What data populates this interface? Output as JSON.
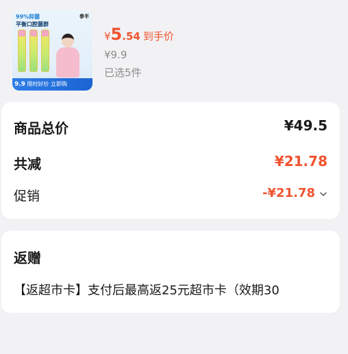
{
  "product": {
    "thumb": {
      "tagline_1": "99%抑菌",
      "tagline_2": "平衡口腔菌群",
      "brand": "参半",
      "promo_price": "9.9",
      "promo_text": "限时好价 立即购"
    },
    "price_currency": "¥",
    "price_integer": "5",
    "price_decimal": ".54",
    "price_label": "到手价",
    "original_price": "¥9.9",
    "selected_text": "已选5件"
  },
  "summary": {
    "total_label": "商品总价",
    "total_value": "¥49.5",
    "reduce_label": "共减",
    "reduce_value": "¥21.78",
    "promo_label": "促销",
    "promo_value": "-¥21.78"
  },
  "gift": {
    "title": "返赠",
    "description": "【返超市卡】支付后最高返25元超市卡（效期30"
  },
  "colors": {
    "accent": "#f0532f",
    "background": "#f2f2f4",
    "card": "#ffffff"
  }
}
